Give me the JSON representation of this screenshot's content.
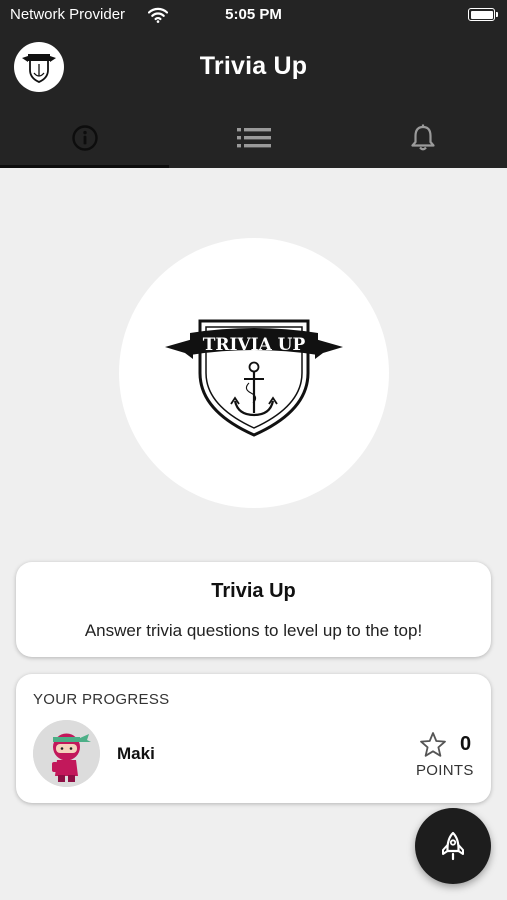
{
  "status_bar": {
    "carrier": "Network Provider",
    "time": "5:05 PM",
    "wifi_icon": "wifi-icon",
    "battery_icon": "battery-icon",
    "battery_level": 1.0
  },
  "app_bar": {
    "title": "Trivia Up",
    "logo_icon": "trivia-up-badge",
    "tabs": [
      {
        "icon": "info-icon",
        "active": true
      },
      {
        "icon": "list-icon",
        "active": false
      },
      {
        "icon": "bell-icon",
        "active": false
      }
    ]
  },
  "hero": {
    "logo_text": "TRIVIA UP",
    "logo_icon": "anchor-shield-badge"
  },
  "info_card": {
    "title": "Trivia Up",
    "description": "Answer trivia questions to level up to the top!"
  },
  "progress_card": {
    "section_label": "YOUR PROGRESS",
    "user_name": "Maki",
    "avatar_icon": "ninja-avatar",
    "points_icon": "star-icon",
    "points_value": "0",
    "points_label": "POINTS"
  },
  "fab": {
    "icon": "rocket-icon"
  },
  "colors": {
    "app_bar": "#242424",
    "background": "#efefef",
    "card": "#ffffff",
    "fab": "#1d1d1d",
    "avatar_accent": "#c2185b"
  }
}
